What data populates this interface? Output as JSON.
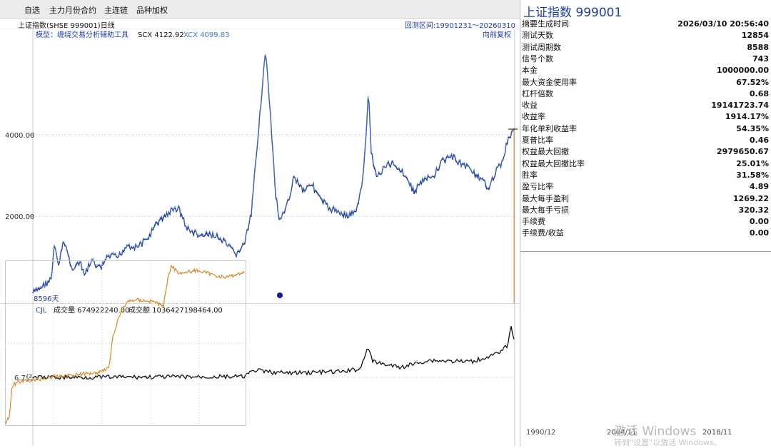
{
  "tabs": [
    "自选",
    "主力月份合约",
    "主连链",
    "品种加权"
  ],
  "header": {
    "left": "上证指数(SHSE 999001)日线",
    "right": "回测区间:19901231～20260310"
  },
  "main": {
    "model": "模型：缠绕交易分析辅助工具",
    "scx": "SCX 4122.92",
    "xcx": "XCX 4099.83",
    "mode": "向前复权",
    "days": "8596天",
    "y_labels": [
      "4000.00",
      "2000.00"
    ]
  },
  "volume": {
    "title": "CJL",
    "vol": "成交量 674922240.00",
    "amt": "成交额 1036427198464.00",
    "y_label": "6.7亿"
  },
  "right": {
    "title": "上证指数  999001",
    "rows": [
      {
        "k": "摘要生成时间",
        "v": "2026/03/10 20:56:40"
      },
      {
        "k": "测试天数",
        "v": "12854"
      },
      {
        "k": "测试周期数",
        "v": "8588"
      },
      {
        "k": "信号个数",
        "v": "743"
      },
      {
        "k": "本金",
        "v": "1000000.00"
      },
      {
        "k": "最大资金使用率",
        "v": "67.52%"
      },
      {
        "k": "杠杆倍数",
        "v": "0.68"
      },
      {
        "k": "收益",
        "v": "19141723.74"
      },
      {
        "k": "收益率",
        "v": "1914.17%"
      },
      {
        "k": "年化单利收益率",
        "v": "54.35%"
      },
      {
        "k": "夏普比率",
        "v": "0.46"
      },
      {
        "k": "权益最大回撤",
        "v": "2979650.67"
      },
      {
        "k": "权益最大回撤比率",
        "v": "25.01%"
      },
      {
        "k": "胜率",
        "v": "31.58%"
      },
      {
        "k": "盈亏比率",
        "v": "4.89"
      },
      {
        "k": "最大每手盈利",
        "v": "1269.22"
      },
      {
        "k": "最大每手亏损",
        "v": "320.32"
      },
      {
        "k": "手续费",
        "v": "0.00"
      },
      {
        "k": "手续费/收益",
        "v": "0.00"
      }
    ],
    "x_labels": [
      "1990/12",
      "2004/11",
      "2018/11"
    ]
  },
  "watermark": {
    "l1": "激活 Windows",
    "l2": "转到\"设置\"以激活 Windows。"
  },
  "colors": {
    "accent": "#1f3fa6",
    "equity": "#d58a2a",
    "price_line": "#1a3a8a"
  }
}
